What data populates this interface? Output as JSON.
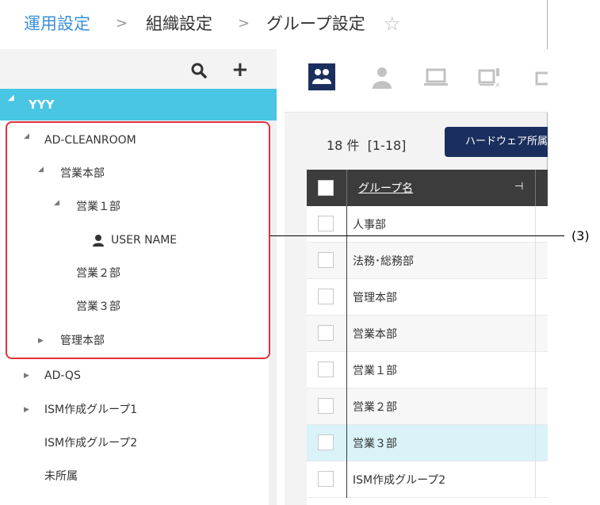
{
  "breadcrumb": {
    "items": [
      "運用設定",
      "組織設定",
      "グループ設定"
    ],
    "separator": ">"
  },
  "left_panel": {
    "tree": [
      {
        "label": "YYY",
        "expanded": true,
        "selected": true
      },
      {
        "label": "AD-CLEANROOM",
        "expanded": true
      },
      {
        "label": "営業本部",
        "expanded": true
      },
      {
        "label": "営業１部",
        "expanded": true
      },
      {
        "label": "USER NAME",
        "type": "user"
      },
      {
        "label": "営業２部"
      },
      {
        "label": "営業３部"
      },
      {
        "label": "管理本部",
        "expanded": false
      },
      {
        "label": "AD-QS",
        "expanded": false
      },
      {
        "label": "ISM作成グループ1",
        "expanded": false
      },
      {
        "label": "ISM作成グループ2"
      },
      {
        "label": "未所属"
      }
    ]
  },
  "right_panel": {
    "count_text": "18 件",
    "range_text": "[1-18]",
    "hardware_button": "ハードウェア所属",
    "table": {
      "header": "グループ名",
      "rows": [
        "人事部",
        "法務･総務部",
        "管理本部",
        "営業本部",
        "営業１部",
        "営業２部",
        "営業３部",
        "ISM作成グループ2"
      ]
    }
  },
  "callout": {
    "label": "(3)"
  },
  "colors": {
    "accent": "#49c6e3",
    "navy": "#1b2f5e",
    "highlight": "#e2323c",
    "link": "#3a8fd8"
  }
}
